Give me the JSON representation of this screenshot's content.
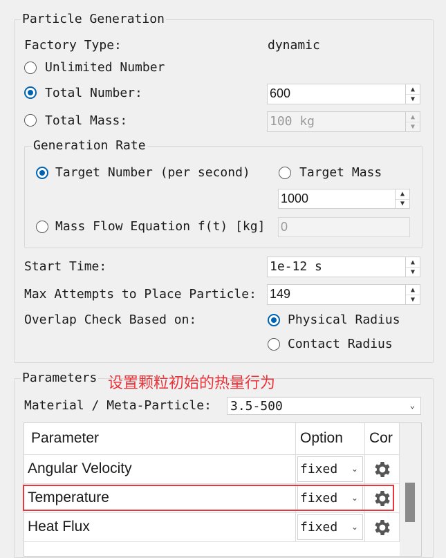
{
  "particle_generation": {
    "title": "Particle Generation",
    "factory_type_label": "Factory Type:",
    "factory_type_value": "dynamic",
    "unlimited_number_label": "Unlimited Number",
    "total_number_label": "Total Number:",
    "total_number_value": "600",
    "total_mass_label": "Total Mass:",
    "total_mass_value": "100 kg",
    "selected_mode": "Total Number",
    "generation_rate": {
      "title": "Generation Rate",
      "target_number_label": "Target Number (per second)",
      "target_mass_label": "Target Mass",
      "rate_value": "1000",
      "mass_flow_label": "Mass Flow Equation f(t) [kg]",
      "mass_flow_value": "0",
      "selected": "Target Number (per second)"
    },
    "start_time_label": "Start Time:",
    "start_time_value": "1e-12 s",
    "max_attempts_label": "Max Attempts to Place Particle:",
    "max_attempts_value": "149",
    "overlap_label": "Overlap Check Based on:",
    "physical_radius_label": "Physical Radius",
    "contact_radius_label": "Contact Radius",
    "overlap_selected": "Physical Radius"
  },
  "parameters": {
    "title": "Parameters",
    "material_label": "Material / Meta-Particle:",
    "material_value": "3.5-500",
    "table": {
      "headers": [
        "Parameter",
        "Option",
        "Cor"
      ],
      "rows": [
        {
          "parameter": "Angular Velocity",
          "option": "fixed",
          "icon": "gear-icon"
        },
        {
          "parameter": "Temperature",
          "option": "fixed",
          "icon": "gear-icon"
        },
        {
          "parameter": "Heat Flux",
          "option": "fixed",
          "icon": "gear-icon"
        }
      ]
    }
  },
  "annotation": {
    "text": "设置颗粒初始的热量行为",
    "color": "#e8353b"
  },
  "colors": {
    "accent": "#0063b1",
    "background": "#f0f0f0"
  }
}
